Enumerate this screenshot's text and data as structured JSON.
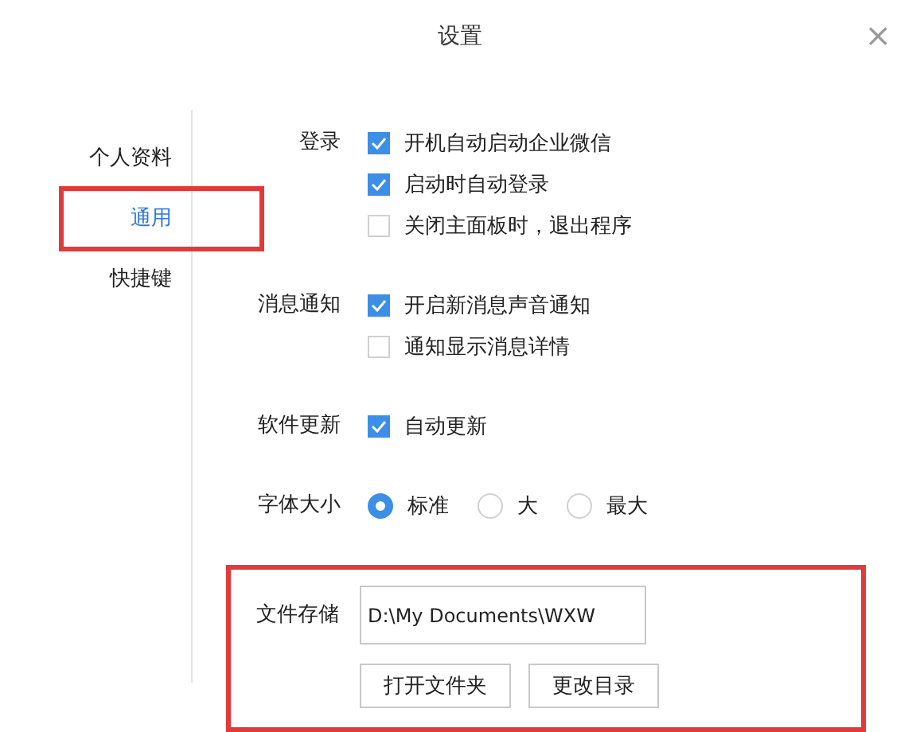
{
  "window": {
    "title": "设置",
    "close": "×"
  },
  "sidebar": {
    "items": [
      {
        "label": "个人资料",
        "selected": false,
        "highlighted": false
      },
      {
        "label": "通用",
        "selected": true,
        "highlighted": true
      },
      {
        "label": "快捷键",
        "selected": false,
        "highlighted": false
      }
    ]
  },
  "sections": [
    {
      "label": "登录",
      "kind": "checkboxes",
      "highlighted": false,
      "options": [
        {
          "label": "开机自动启动企业微信",
          "checked": true
        },
        {
          "label": "启动时自动登录",
          "checked": true
        },
        {
          "label": "关闭主面板时，退出程序",
          "checked": false
        }
      ]
    },
    {
      "label": "消息通知",
      "kind": "checkboxes",
      "highlighted": false,
      "options": [
        {
          "label": "开启新消息声音通知",
          "checked": true
        },
        {
          "label": "通知显示消息详情",
          "checked": false
        }
      ]
    },
    {
      "label": "软件更新",
      "kind": "checkboxes",
      "highlighted": false,
      "options": [
        {
          "label": "自动更新",
          "checked": true
        }
      ]
    },
    {
      "label": "字体大小",
      "kind": "radios",
      "highlighted": false,
      "options": [
        {
          "label": "标准",
          "selected": true
        },
        {
          "label": "大",
          "selected": false
        },
        {
          "label": "最大",
          "selected": false
        }
      ]
    },
    {
      "label": "文件存储",
      "kind": "storage",
      "highlighted": true,
      "value": "D:\\My Documents\\WXW",
      "buttons": [
        "打开文件夹",
        "更改目录"
      ]
    }
  ]
}
